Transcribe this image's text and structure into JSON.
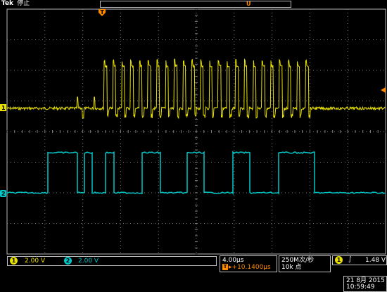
{
  "header": {
    "brand": "Tek",
    "run_state": "停止",
    "trigger_marker": "T",
    "cursor_marker": "U"
  },
  "channels": {
    "ch1": {
      "id": "1",
      "color": "#e8e000",
      "scale": "2.00 V"
    },
    "ch2": {
      "id": "2",
      "color": "#00c8c8",
      "scale": "2.00 V"
    }
  },
  "timebase": {
    "scale": "4.00µs",
    "position_label": "T",
    "position_value": "+10.1400µs"
  },
  "acquisition": {
    "sample_rate": "250M次/秒",
    "record_length": "10k 点"
  },
  "trigger": {
    "source": "1",
    "slope_icon": "rising-edge-icon",
    "level": "1.48 V"
  },
  "datetime": {
    "date": "21 8月 2015",
    "time": "10:59:49"
  },
  "colors": {
    "grid": "#7f7f7f",
    "frame": "#b8b8b8",
    "ch1": "#e8e000",
    "ch2": "#00c8c8",
    "trigger_marker": "#ff8a00"
  }
}
